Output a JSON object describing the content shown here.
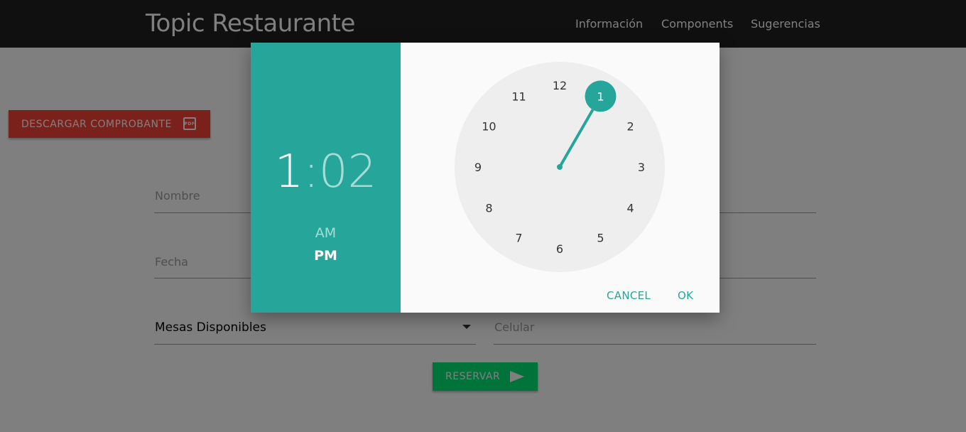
{
  "navbar": {
    "brand": "Topic Restaurante",
    "links": [
      "Información",
      "Components",
      "Sugerencias"
    ]
  },
  "page": {
    "pdf_button_label": "DESCARGAR COMPROBANTE",
    "pdf_icon_text": "PDF",
    "fields": {
      "nombre": "Nombre",
      "fecha": "Fecha",
      "mesas": "Mesas Disponibles",
      "celular": "Celular"
    },
    "reservar_label": "RESERVAR"
  },
  "timepicker": {
    "hours": "1",
    "colon": ":",
    "minutes": "02",
    "am_label": "AM",
    "pm_label": "PM",
    "selected_period": "PM",
    "clock_numbers": [
      "12",
      "1",
      "2",
      "3",
      "4",
      "5",
      "6",
      "7",
      "8",
      "9",
      "10",
      "11"
    ],
    "selected_hour": 1,
    "cancel_label": "CANCEL",
    "ok_label": "OK",
    "accent_color": "#26a69a"
  },
  "colors": {
    "navbar": "#212121",
    "pdf_button": "#f44336",
    "reservar_button": "#00e676"
  }
}
